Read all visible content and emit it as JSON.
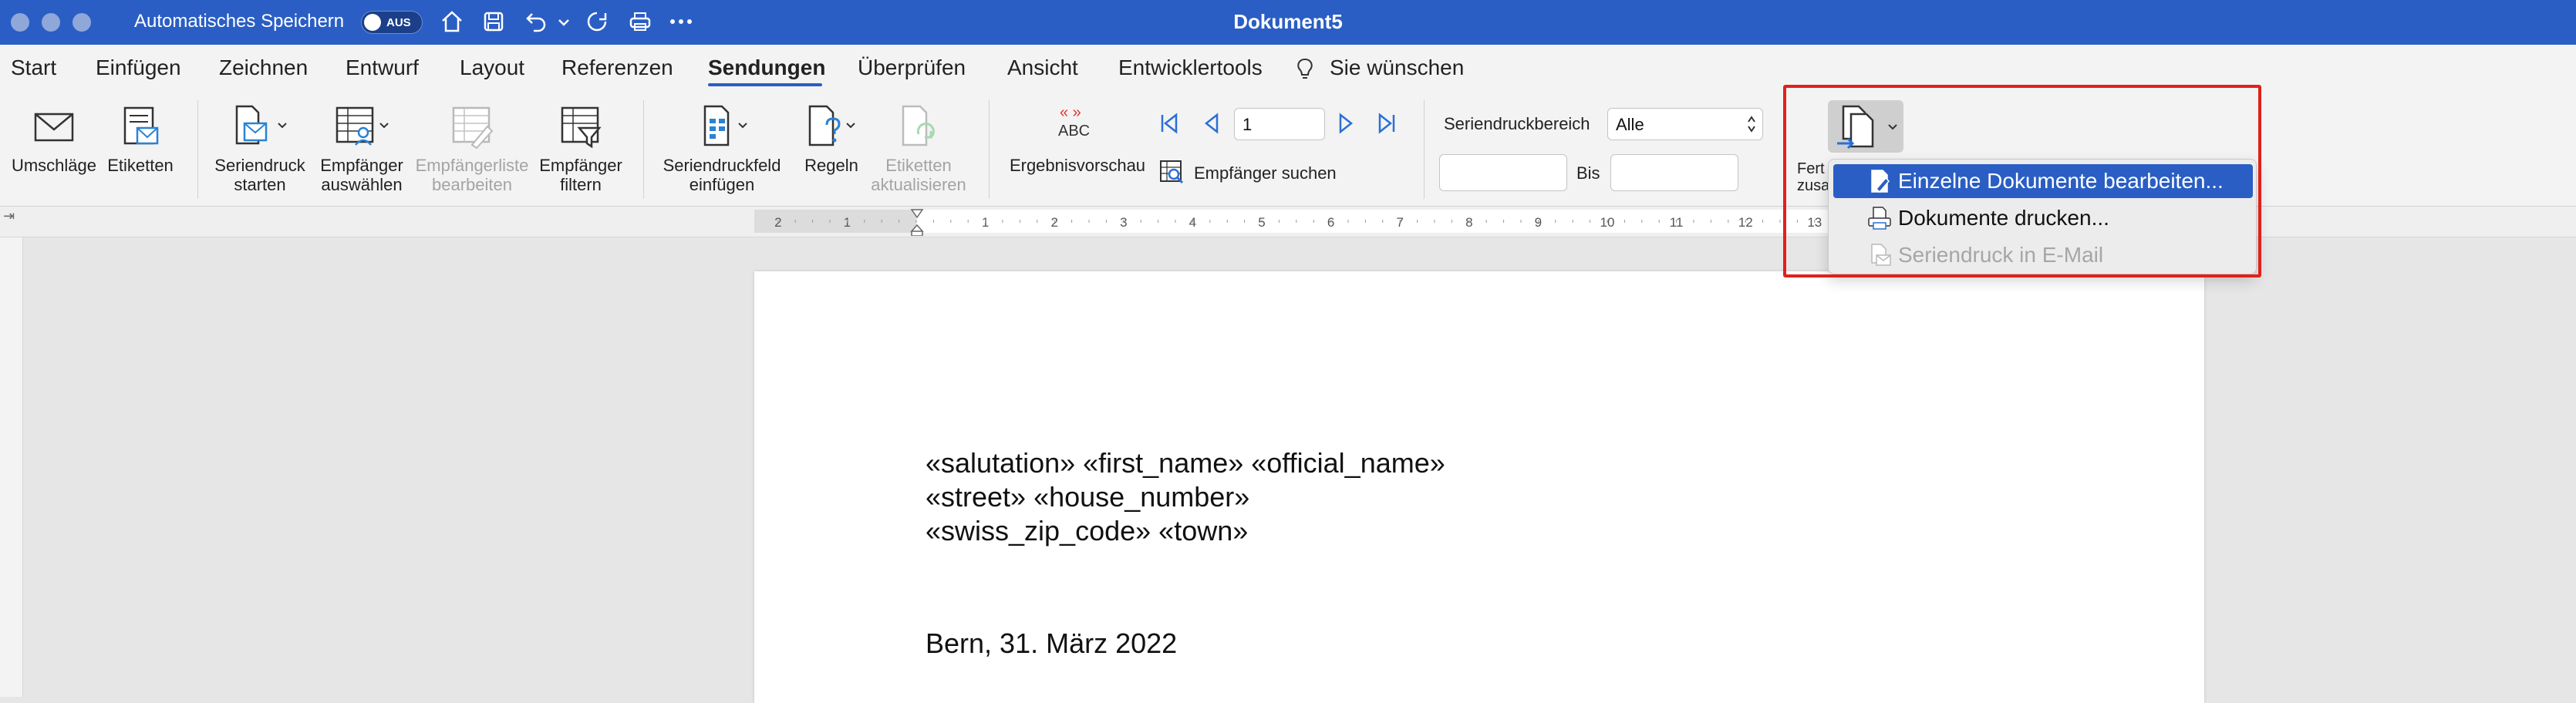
{
  "titlebar": {
    "autosave_label": "Automatisches Speichern",
    "toggle_label": "AUS",
    "document_title": "Dokument5",
    "icons": [
      "home-icon",
      "save-icon",
      "undo-icon",
      "chevron-down-icon",
      "redo-icon",
      "print-icon",
      "more-icon"
    ]
  },
  "menu": {
    "tabs": [
      "Start",
      "Einfügen",
      "Zeichnen",
      "Entwurf",
      "Layout",
      "Referenzen",
      "Sendungen",
      "Überprüfen",
      "Ansicht",
      "Entwicklertools"
    ],
    "active_tab": "Sendungen",
    "tell_me": "Sie wünschen"
  },
  "ribbon": {
    "umschlaege": "Umschläge",
    "etiketten": "Etiketten",
    "seriendruck_l1": "Seriendruck",
    "seriendruck_l2": "starten",
    "empfaenger_l1": "Empfänger",
    "empfaenger_l2": "auswählen",
    "liste_l1": "Empfängerliste",
    "liste_l2": "bearbeiten",
    "filtern_l1": "Empfänger",
    "filtern_l2": "filtern",
    "feld_l1": "Seriendruckfeld",
    "feld_l2": "einfügen",
    "regeln": "Regeln",
    "etaktual_l1": "Etiketten",
    "etaktual_l2": "aktualisieren",
    "vorschau": "Ergebnisvorschau",
    "vorschau_icon_text": "ABC",
    "record_value": "1",
    "empfaenger_suchen": "Empfänger suchen",
    "bereich_label": "Seriendruckbereich",
    "bereich_value": "Alle",
    "bis_label": "Bis",
    "fertig_l1": "Fert",
    "fertig_l2": "zusa"
  },
  "ruler": {
    "ticks": [
      "2",
      "1",
      "1",
      "2",
      "3",
      "4",
      "5",
      "6",
      "7",
      "8",
      "9",
      "10",
      "11",
      "12",
      "13"
    ]
  },
  "document": {
    "line1": "«salutation» «first_name» «official_name»",
    "line2": "«street» «house_number»",
    "line3": "«swiss_zip_code» «town»",
    "line4": "Bern, 31. März 2022"
  },
  "dropdown": {
    "items": [
      {
        "label": "Einzelne Dokumente bearbeiten...",
        "selected": true,
        "enabled": true
      },
      {
        "label": "Dokumente drucken...",
        "selected": false,
        "enabled": true
      },
      {
        "label": "Seriendruck in E-Mail",
        "selected": false,
        "enabled": false
      }
    ]
  },
  "colors": {
    "accent": "#2a5ec4",
    "highlight_box": "#e0211b"
  }
}
